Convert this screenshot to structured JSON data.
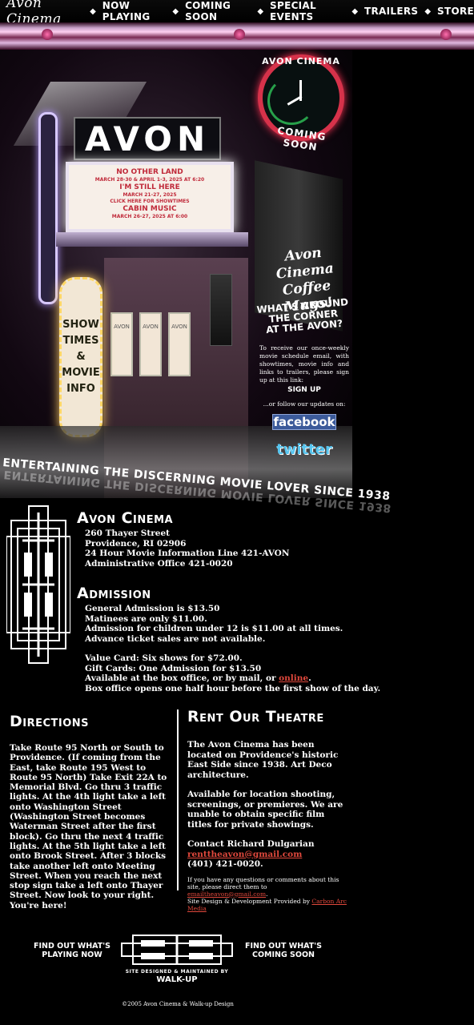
{
  "nav": {
    "brand": "Avon Cinema",
    "items": [
      "NOW PLAYING",
      "COMING SOON",
      "SPECIAL EVENTS",
      "TRAILERS",
      "STORE"
    ]
  },
  "hero": {
    "sign": "AVON",
    "marquee": [
      {
        "title": "NO OTHER LAND",
        "sub": "MARCH 28-30 & APRIL 1-3, 2025 AT 6:20"
      },
      {
        "title": "I'M STILL HERE",
        "sub": "MARCH 21-27, 2025"
      },
      {
        "title": "",
        "sub": "CLICK HERE FOR SHOWTIMES"
      },
      {
        "title": "CABIN MUSIC",
        "sub": "MARCH 26-27, 2025 AT 6:00"
      }
    ],
    "showtimes": [
      "SHOW",
      "TIMES",
      "&",
      "MOVIE",
      "INFO"
    ],
    "door_label": "AVON"
  },
  "clock": {
    "top": "AVON CINEMA",
    "bottom": "COMING SOON"
  },
  "sidebar": {
    "mugs": [
      "Avon Cinema",
      "Coffee Mugs!"
    ],
    "whats_around": [
      "WHAT'S AROUND",
      "THE CORNER",
      "AT THE AVON?"
    ],
    "signup_text": "To receive our once-weekly movie schedule email, with showtimes, movie info and links to trailers, please sign up at this link:",
    "signup": "SIGN UP",
    "follow": "...or follow our updates on:",
    "facebook": "facebook",
    "twitter": "twitter"
  },
  "tagline": "ENTERTAINING THE DISCERNING MOVIE LOVER SINCE 1938",
  "avon": {
    "title": "Avon Cinema",
    "lines": [
      "260 Thayer Street",
      "Providence, RI 02906",
      "24 Hour Movie Information Line 421-AVON",
      "Administrative Office 421-0020"
    ]
  },
  "admission": {
    "title": "Admission",
    "lines": [
      "General Admission is $13.50",
      "Matinees are only $11.00.",
      "Admission for children under 12 is $11.00 at all times.",
      "Advance ticket sales are not available."
    ],
    "lines2": [
      "Value Card: Six shows for $72.00.",
      "Gift Cards: One Admission for $13.50"
    ],
    "avail_pre": "Available at the box office, or by mail, or ",
    "avail_link": "online",
    "avail_post": ".",
    "box_office": "Box office opens one half hour before the first show of the day."
  },
  "directions": {
    "title": "Directions",
    "body": "Take Route 95 North or South to Providence. (If coming from the East, take Route 195 West to Route 95 North) Take Exit 22A to Memorial Blvd. Go thru 3 traffic lights. At the 4th light take a left onto Washington Street (Washington Street becomes Waterman Street after the first block). Go thru the next 4 traffic lights. At the 5th light take a left onto Brook Street. After 3 blocks take another left onto Meeting Street. When you reach the next stop sign take a left onto Thayer Street. Now look to your right. You're here!"
  },
  "rent": {
    "title": "Rent Our Theatre",
    "p1": "The Avon Cinema has been located on Providence's historic East Side since 1938. Art Deco architecture.",
    "p2": "Available for location shooting, screenings, or premieres. We are unable to obtain specific film titles for private showings.",
    "contact": "Contact Richard Dulgarian",
    "email": "renttheavon@gmail.com",
    "phone": "(401) 421-0020.",
    "questions_pre": "If you have any questions or comments about this site, please direct them to ",
    "questions_email": "emailtheavon@gmail.com",
    "questions_post": ".",
    "design_pre": "Site Design & Development Provided by ",
    "design_link": "Carbon Arc Media"
  },
  "footer": {
    "left": [
      "FIND OUT WHAT'S",
      "PLAYING NOW"
    ],
    "right": [
      "FIND OUT WHAT'S",
      "COMING SOON"
    ],
    "walkup_small": "SITE DESIGNED & MAINTAINED BY",
    "walkup": "WALK-UP",
    "copyright": "©2005 Avon Cinema & Walk-up Design"
  }
}
